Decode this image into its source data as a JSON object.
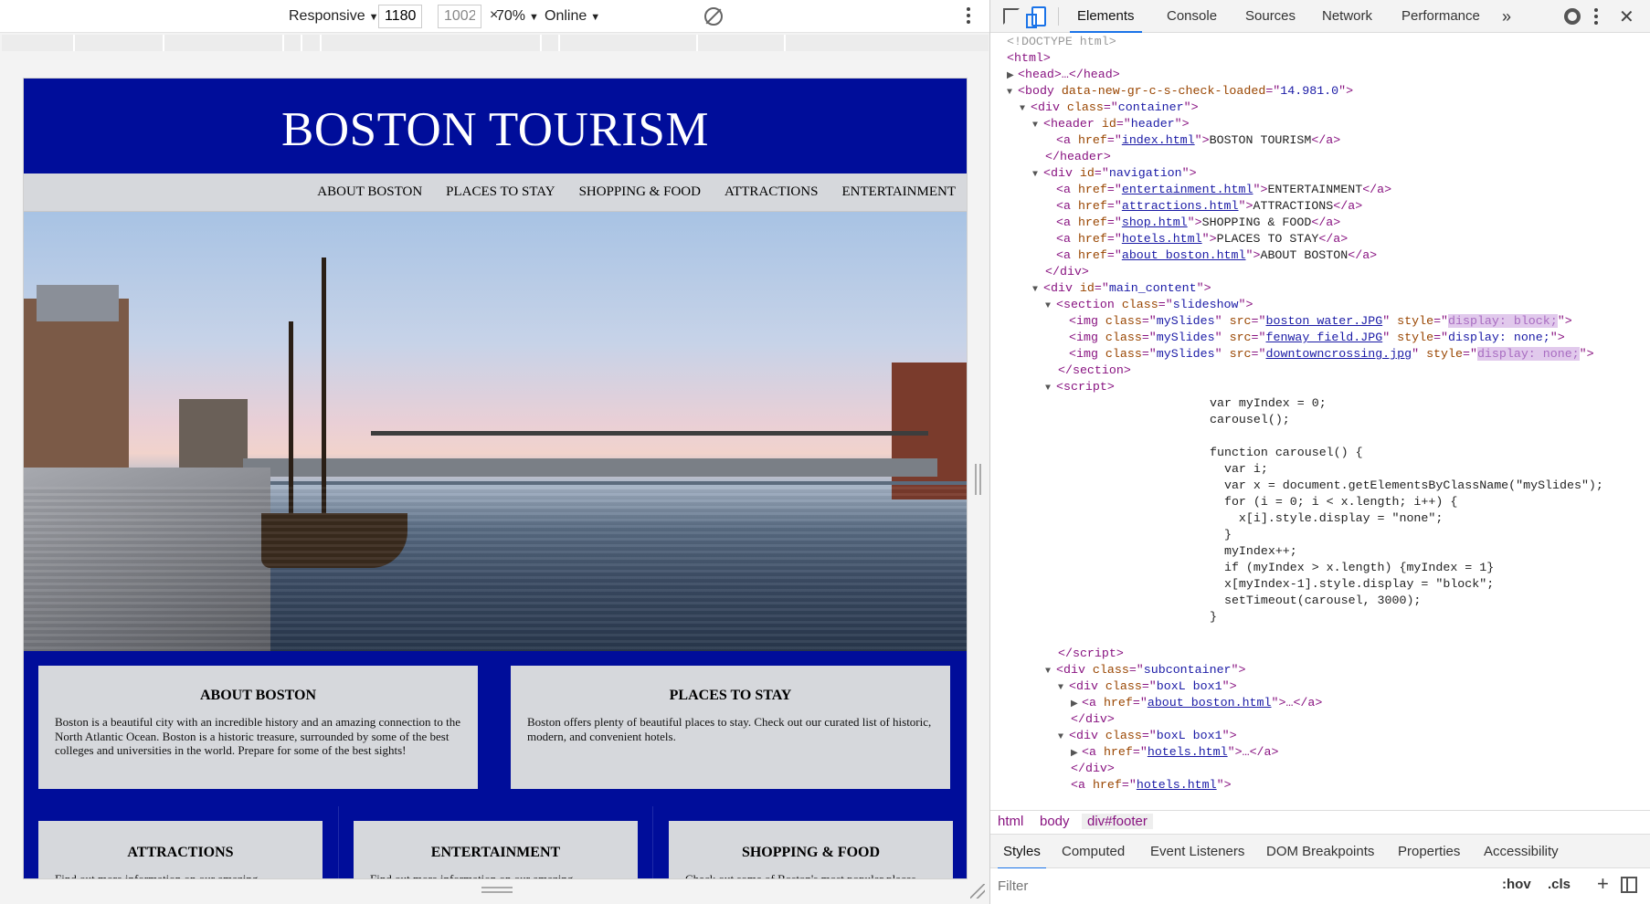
{
  "toolbar": {
    "device": "Responsive",
    "width": "1180",
    "times": "×",
    "height": "1002",
    "zoom": "70%",
    "network": "Online"
  },
  "site": {
    "title": "BOSTON TOURISM",
    "nav": [
      "ABOUT BOSTON",
      "PLACES TO STAY",
      "SHOPPING & FOOD",
      "ATTRACTIONS",
      "ENTERTAINMENT"
    ],
    "boxes": [
      {
        "title": "ABOUT BOSTON",
        "text": "Boston is a beautiful city with an incredible history and an amazing connection to the North Atlantic Ocean. Boston is a historic treasure, surrounded by some of the best colleges and universities in the world. Prepare for some of the best sights!"
      },
      {
        "title": "PLACES TO STAY",
        "text": "Boston offers plenty of beautiful places to stay. Check out our curated list of historic, modern, and convenient hotels."
      }
    ],
    "small_boxes": [
      {
        "title": "ATTRACTIONS",
        "text": "Find out more information on our amazing"
      },
      {
        "title": "ENTERTAINMENT",
        "text": "Find out more information on our amazing"
      },
      {
        "title": "SHOPPING & FOOD",
        "text": "Check out some of Boston's most popular places"
      }
    ]
  },
  "devtools": {
    "tabs": [
      "Elements",
      "Console",
      "Sources",
      "Network",
      "Performance"
    ],
    "more": "»",
    "breadcrumbs": [
      "html",
      "body",
      "div#footer"
    ],
    "sub_tabs": [
      "Styles",
      "Computed",
      "Event Listeners",
      "DOM Breakpoints",
      "Properties",
      "Accessibility"
    ],
    "filter_placeholder": "Filter",
    "hov": ":hov",
    "cls": ".cls"
  },
  "dom": {
    "doctype": "<!DOCTYPE html>",
    "html": "<html>",
    "head": "<head>…</head>",
    "body_attr": "data-new-gr-c-s-check-loaded",
    "body_val": "14.981.0",
    "container": "container",
    "header_id": "header",
    "header_href": "index.html",
    "header_text": "BOSTON TOURISM",
    "nav_id": "navigation",
    "nav_links": [
      {
        "href": "entertainment.html",
        "text": "ENTERTAINMENT"
      },
      {
        "href": "attractions.html",
        "text": "ATTRACTIONS"
      },
      {
        "href": "shop.html",
        "text": "SHOPPING & FOOD"
      },
      {
        "href": "hotels.html",
        "text": "PLACES TO STAY"
      },
      {
        "href": "about_boston.html",
        "text": "ABOUT BOSTON"
      }
    ],
    "main_id": "main_content",
    "section_class": "slideshow",
    "imgs": [
      {
        "src": "boston_water.JPG",
        "style": "display: block;",
        "hl": true
      },
      {
        "src": "fenway_field.JPG",
        "style": "display: none;",
        "hl": false
      },
      {
        "src": "downtowncrossing.jpg",
        "style": "display: none;",
        "hl": true
      }
    ],
    "img_class": "mySlides",
    "script": [
      "var myIndex = 0;",
      "carousel();",
      "",
      "function carousel() {",
      "  var i;",
      "  var x = document.getElementsByClassName(\"mySlides\");",
      "  for (i = 0; i < x.length; i++) {",
      "    x[i].style.display = \"none\";",
      "  }",
      "  myIndex++;",
      "  if (myIndex > x.length) {myIndex = 1}",
      "  x[myIndex-1].style.display = \"block\";",
      "  setTimeout(carousel, 3000);",
      "}"
    ],
    "subcontainer": "subcontainer",
    "box_class": "boxL box1",
    "box_links": [
      "about_boston.html",
      "hotels.html",
      "hotels.html"
    ]
  }
}
